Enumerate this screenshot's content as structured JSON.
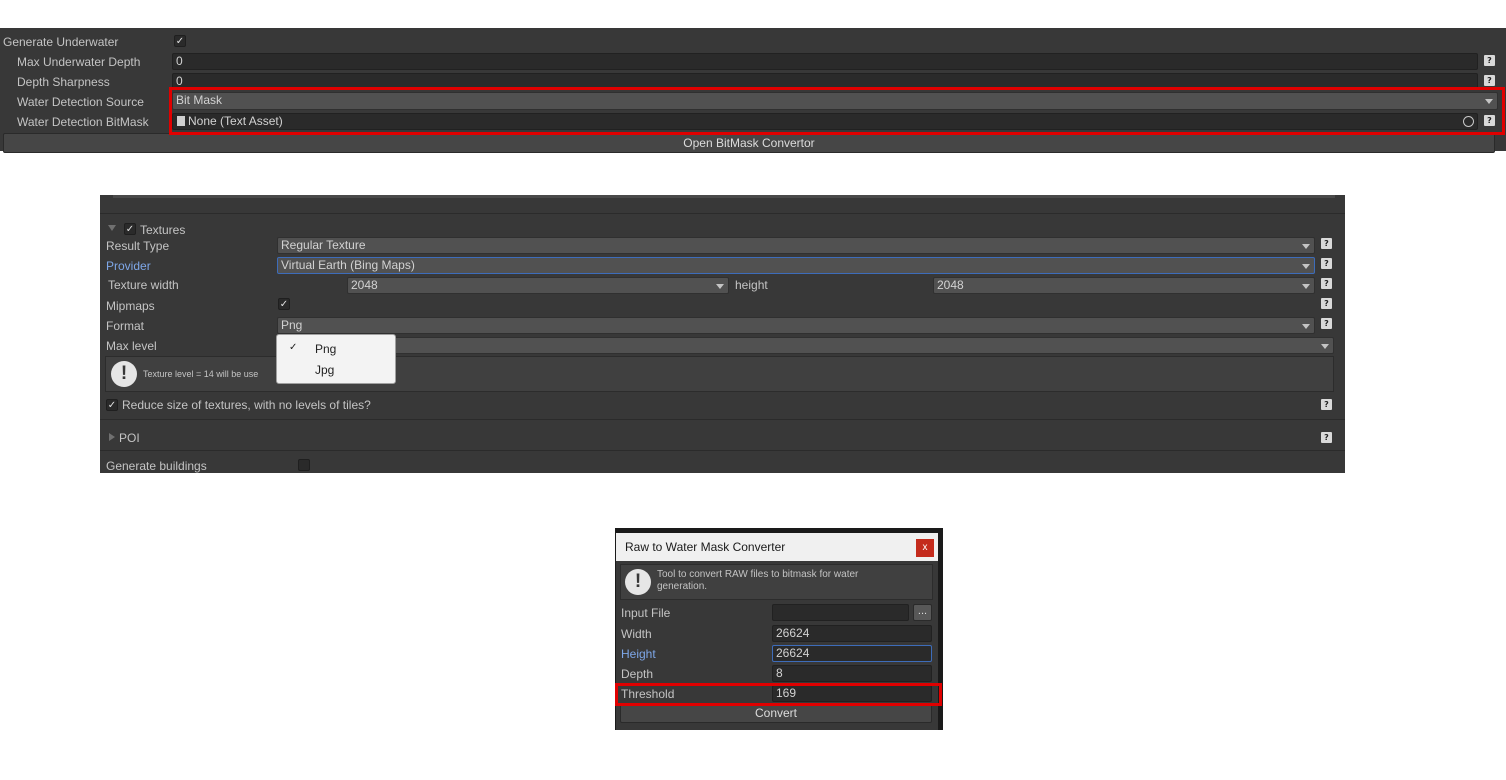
{
  "panel1": {
    "generate_underwater_label": "Generate Underwater",
    "generate_underwater_checked": true,
    "max_underwater_depth_label": "Max Underwater Depth",
    "max_underwater_depth_value": "0",
    "depth_sharpness_label": "Depth Sharpness",
    "depth_sharpness_value": "0",
    "water_detection_source_label": "Water Detection Source",
    "water_detection_source_value": "Bit Mask",
    "water_detection_bitmask_label": "Water Detection BitMask",
    "water_detection_bitmask_value": "None (Text Asset)",
    "open_button_label": "Open BitMask Convertor",
    "help_glyph": "?"
  },
  "panel2": {
    "textures_label": "Textures",
    "result_type_label": "Result Type",
    "result_type_value": "Regular Texture",
    "provider_label": "Provider",
    "provider_value": "Virtual Earth (Bing Maps)",
    "texture_width_label": "Texture width",
    "texture_width_value": "2048",
    "height_label": "height",
    "height_value": "2048",
    "mipmaps_label": "Mipmaps",
    "format_label": "Format",
    "format_value": "Png",
    "max_level_label": "Max level",
    "info_text": "Texture level = 14 will be use",
    "reduce_label": "Reduce size of textures, with no levels of tiles?",
    "poi_label": "POI",
    "generate_buildings_label": "Generate buildings",
    "dropdown_options": [
      "Png",
      "Jpg"
    ],
    "selected_mark": "✓"
  },
  "panel3": {
    "title": "Raw to Water Mask Converter",
    "close_label": "x",
    "info_text": "Tool to convert RAW files to bitmask for water generation.",
    "input_file_label": "Input File",
    "input_file_value": "",
    "browse_label": "...",
    "width_label": "Width",
    "width_value": "26624",
    "height_label": "Height",
    "height_value": "26624",
    "depth_label": "Depth",
    "depth_value": "8",
    "threshold_label": "Threshold",
    "threshold_value": "169",
    "convert_label": "Convert"
  },
  "colors": {
    "panel_bg": "#383838",
    "field_bg": "#2a2a2a",
    "accent_blue": "#7ea7e8",
    "highlight_red": "#e00000"
  }
}
